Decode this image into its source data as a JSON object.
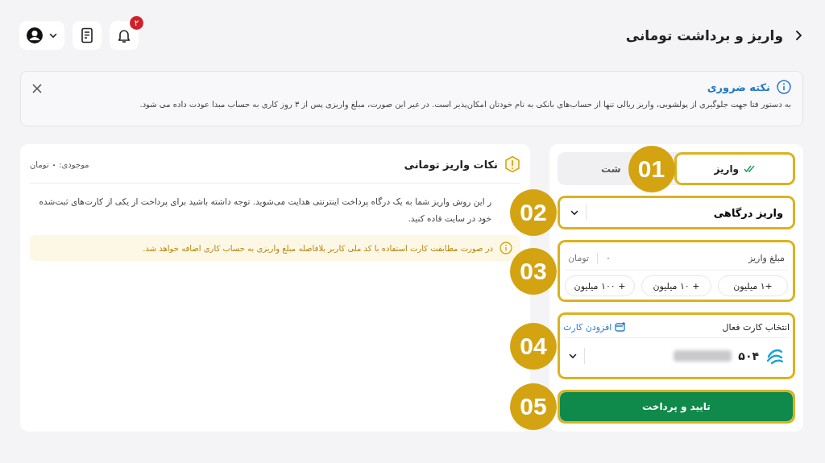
{
  "header": {
    "title": "واریز و برداشت تومانی",
    "notification_count": "۲"
  },
  "notice": {
    "title": "نکته ضروری",
    "text": "به دستور فتا جهت جلوگیری از پولشویی، واریز ریالی تنها از حساب‌های بانکی به نام خودتان امکان‌پذیر است. در غیر این صورت، مبلغ واریزی پس از ۳ روز کاری به حساب مبدا عودت داده می شود."
  },
  "tips": {
    "title": "نکات واریز تومانی",
    "balance": "موجودی: **۰** تومان",
    "text": "ر این روش واریز شما به یک درگاه پرداخت اینترنتی هدایت می‌شوید. توجه داشته باشید برای پرداخت از یکی از کارت‌های ثبت‌شده خود در سایت فاده کنید.",
    "note": "در صورت مطابقت کارت استفاده با کد ملی کاربر بلافاصله مبلغ واریزی به حساب کاری اضافه خواهد شد."
  },
  "deposit_form": {
    "tabs": [
      {
        "label": "واریز",
        "selected": true
      },
      {
        "label": "شت",
        "selected": false
      }
    ],
    "method": "واریز درگاهی",
    "amount": {
      "label": "مبلغ واریز",
      "value": "۰",
      "unit": "تومان"
    },
    "presets": [
      "+۱ میلیون",
      "+ ۱۰ میلیون",
      "+ ۱۰۰ میلیون"
    ],
    "card": {
      "label": "انتخاب کارت فعال",
      "add_link": "افزودن کارت",
      "number": "۵۰۴"
    },
    "submit": "تایید و پرداخت"
  },
  "callouts": [
    "01",
    "02",
    "03",
    "04",
    "05"
  ]
}
